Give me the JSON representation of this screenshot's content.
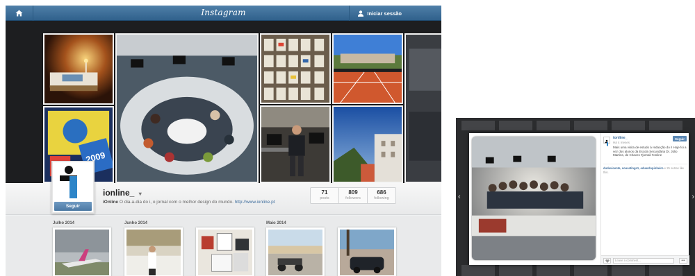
{
  "profile_page": {
    "topbar": {
      "home_icon": "home-icon",
      "brand": "Instagram",
      "login_icon": "user-icon",
      "login_label": "Iniciar sessão"
    },
    "profile": {
      "username": "ionline_",
      "dropdown_glyph": "▾",
      "bio_name": "iOnline",
      "bio_text": " O dia-a-dia do i, o jornal com o melhor design do mundo. ",
      "bio_link": "http://www.ionline.pt",
      "follow_label": "Seguir",
      "stats": [
        {
          "value": "71",
          "label": "posts"
        },
        {
          "value": "809",
          "label": "followers"
        },
        {
          "value": "686",
          "label": "following"
        }
      ]
    },
    "feed": {
      "months": [
        "Julho 2014",
        "Junho 2014",
        "Maio 2014"
      ]
    }
  },
  "photo_modal": {
    "username": "ionline_",
    "time": "Há 4 meses",
    "follow_label": "Seguir",
    "caption": "Mais uma visita de estudo à redacção do i! Hoje foi a vez dos alunos da Escola Secundária Dr. Júlio Martins, de Chaves #jornali #online",
    "likes_names": "dudavicente, sousatings1, eduardopinheiro",
    "likes_suffix": " e 25 outras like this.",
    "comment_placeholder": "Leave a comment...",
    "more_label": "•••",
    "heart_icon": "heart-icon",
    "prev_glyph": "‹",
    "next_glyph": "›"
  }
}
